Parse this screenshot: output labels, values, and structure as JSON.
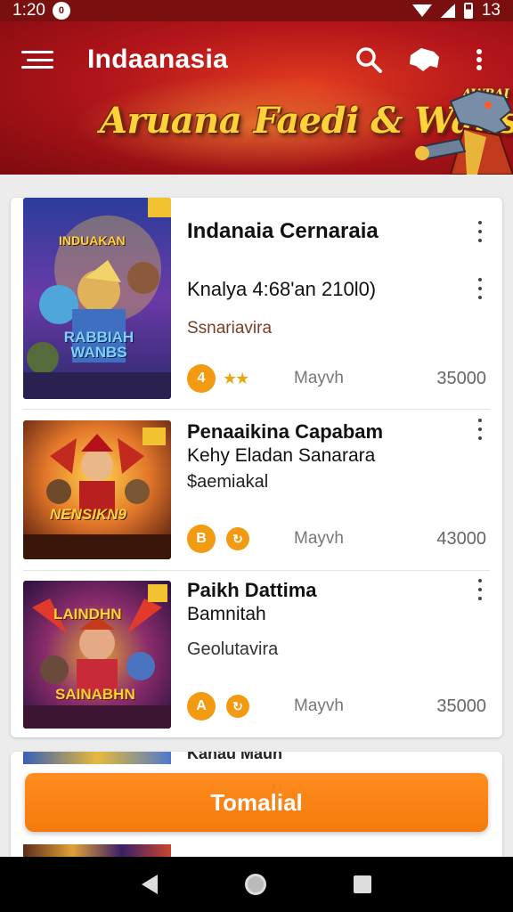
{
  "status_bar": {
    "time": "1:20",
    "indicator": "0",
    "right_text": "13"
  },
  "app_bar": {
    "title": "Indaanasia",
    "banner_title": "Aruana Faedi & Wans!",
    "banner_small": "AWRAI",
    "icons": [
      "menu-icon",
      "search-icon",
      "game-controller-icon",
      "more-vert-icon"
    ]
  },
  "items": [
    {
      "title": "Indanaia Cernaraia",
      "subtitle": "Knalya 4:68'an 210l0)",
      "category": "Ssnariavira",
      "thumb_title": "INDUAKAN",
      "thumb_sub": "RABBIAH WANBS",
      "badge": "4",
      "stars": "★★",
      "label": "Mayvh",
      "price": "35000"
    },
    {
      "title": "Penaaikina Capabam",
      "subtitle": "Kehy Eladan Sanarara",
      "category": "$aemiakal",
      "thumb_title": "NENSIKN9",
      "thumb_sub": "",
      "badge": "B",
      "badge2": "↻",
      "label": "Mayvh",
      "price": "43000"
    },
    {
      "title": "Paikh Dattima",
      "subtitle": "Bamnitah",
      "category": "Geolutavira",
      "thumb_title": "LAINDHN",
      "thumb_sub": "SAINABHN",
      "badge": "A",
      "badge2": "↻",
      "label": "Mayvh",
      "price": "35000"
    }
  ],
  "partial_item": {
    "title": "Kanau Maun"
  },
  "cta": {
    "label": "Tomalial"
  },
  "colors": {
    "app_bar": "#b3151a",
    "accent": "#f57a0d",
    "badge": "#f29a12"
  }
}
